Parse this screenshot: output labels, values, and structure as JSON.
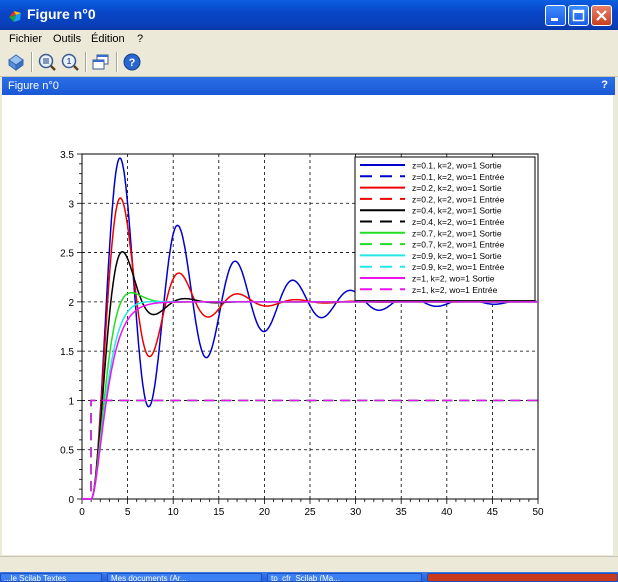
{
  "window": {
    "title": "Figure n°0",
    "icon": "scilab-icon"
  },
  "window_controls": {
    "minimize": "minimize-icon",
    "maximize": "maximize-icon",
    "close": "close-icon"
  },
  "menu": {
    "items": [
      "Fichier",
      "Outils",
      "Édition",
      "?"
    ]
  },
  "toolbar": {
    "icons": [
      "rotate-icon",
      "zoom-in-icon",
      "zoom-reset-icon",
      "new-window-icon",
      "help-icon"
    ]
  },
  "figure_header": {
    "label": "Figure n°0",
    "help": "?"
  },
  "colors": {
    "title_bar": "#0a46c8",
    "figure_bar": "#1a58d6",
    "menu_bg": "#ece9d8"
  },
  "chart_data": {
    "type": "line",
    "title": "",
    "xlabel": "",
    "ylabel": "",
    "xlim": [
      0,
      50
    ],
    "ylim": [
      0,
      3.5
    ],
    "x_ticks": [
      "0",
      "5",
      "10",
      "15",
      "20",
      "25",
      "30",
      "35",
      "40",
      "45",
      "50"
    ],
    "y_ticks": [
      "0",
      "0.5",
      "1",
      "1.5",
      "2",
      "2.5",
      "3",
      "3.5"
    ],
    "grid": true,
    "legend_position": "top-right",
    "series": [
      {
        "name": "z=0.1, k=2, wo=1 Sortie",
        "color": "#0000cc",
        "dashed": false,
        "zeta": 0.1,
        "k": 2
      },
      {
        "name": "z=0.1, k=2, wo=1 Entrée",
        "color": "#0000cc",
        "dashed": true,
        "input": 1
      },
      {
        "name": "z=0.2, k=2, wo=1 Sortie",
        "color": "#ee0000",
        "dashed": false,
        "zeta": 0.2,
        "k": 2
      },
      {
        "name": "z=0.2, k=2, wo=1 Entrée",
        "color": "#ee0000",
        "dashed": true,
        "input": 1
      },
      {
        "name": "z=0.4, k=2, wo=1 Sortie",
        "color": "#000000",
        "dashed": false,
        "zeta": 0.4,
        "k": 2
      },
      {
        "name": "z=0.4, k=2, wo=1 Entrée",
        "color": "#000000",
        "dashed": true,
        "input": 1
      },
      {
        "name": "z=0.7, k=2, wo=1 Sortie",
        "color": "#22dd22",
        "dashed": false,
        "zeta": 0.7,
        "k": 2
      },
      {
        "name": "z=0.7, k=2, wo=1 Entrée",
        "color": "#22dd22",
        "dashed": true,
        "input": 1
      },
      {
        "name": "z=0.9, k=2, wo=1 Sortie",
        "color": "#22e8e8",
        "dashed": false,
        "zeta": 0.9,
        "k": 2
      },
      {
        "name": "z=0.9, k=2, wo=1 Entrée",
        "color": "#22e8e8",
        "dashed": true,
        "input": 1
      },
      {
        "name": "z=1, k=2, wo=1 Sortie",
        "color": "#ee11ee",
        "dashed": false,
        "zeta": 1.0,
        "k": 2
      },
      {
        "name": "z=1, k=2, wo=1 Entrée",
        "color": "#ee11ee",
        "dashed": true,
        "input": 1
      }
    ]
  },
  "taskbar": {
    "items": [
      "...le Scilab Textes",
      "Mes documents (Ar...",
      "tp_cfr_Scilab (Ma...",
      ""
    ]
  }
}
